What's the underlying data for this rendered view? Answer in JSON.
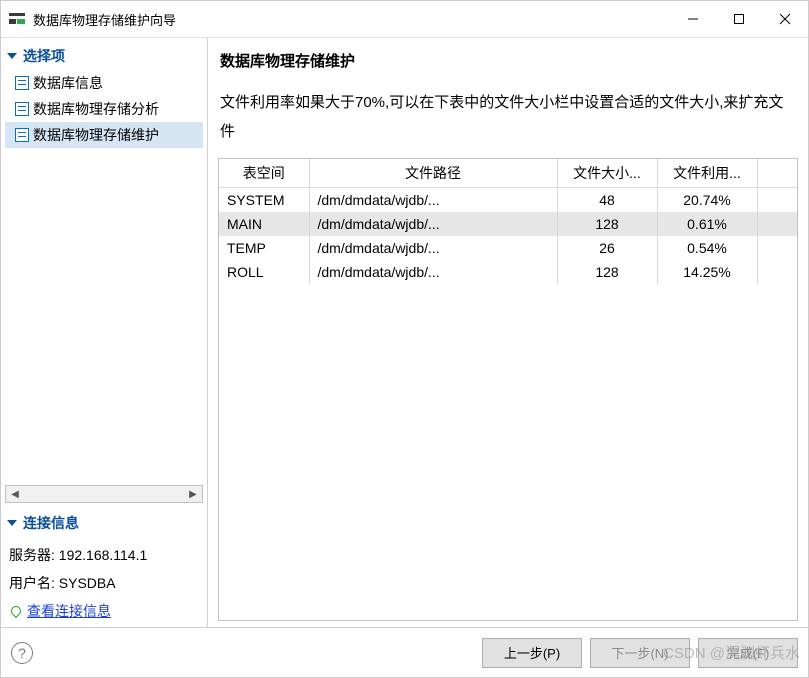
{
  "window": {
    "title": "数据库物理存储维护向导"
  },
  "sidebar": {
    "options_header": "选择项",
    "items": [
      {
        "label": "数据库信息",
        "selected": false
      },
      {
        "label": "数据库物理存储分析",
        "selected": false
      },
      {
        "label": "数据库物理存储维护",
        "selected": true
      }
    ],
    "connection_header": "连接信息",
    "server_label": "服务器:",
    "server_value": "192.168.114.1",
    "user_label": "用户名:",
    "user_value": "SYSDBA",
    "view_link": "查看连接信息"
  },
  "main": {
    "title": "数据库物理存储维护",
    "description": "文件利用率如果大于70%,可以在下表中的文件大小栏中设置合适的文件大小,来扩充文件"
  },
  "table": {
    "headers": [
      "表空间",
      "文件路径",
      "文件大小...",
      "文件利用..."
    ],
    "rows": [
      {
        "ts": "SYSTEM",
        "path": "/dm/dmdata/wjdb/...",
        "size": "48",
        "util": "20.74%",
        "selected": false
      },
      {
        "ts": "MAIN",
        "path": "/dm/dmdata/wjdb/...",
        "size": "128",
        "util": "0.61%",
        "selected": true
      },
      {
        "ts": "TEMP",
        "path": "/dm/dmdata/wjdb/...",
        "size": "26",
        "util": "0.54%",
        "selected": false
      },
      {
        "ts": "ROLL",
        "path": "/dm/dmdata/wjdb/...",
        "size": "128",
        "util": "14.25%",
        "selected": false
      }
    ]
  },
  "footer": {
    "prev": "上一步(P)",
    "next": "下一步(N)",
    "finish": "完成(F)"
  },
  "watermark": "CSDN @溟渊虾兵水"
}
